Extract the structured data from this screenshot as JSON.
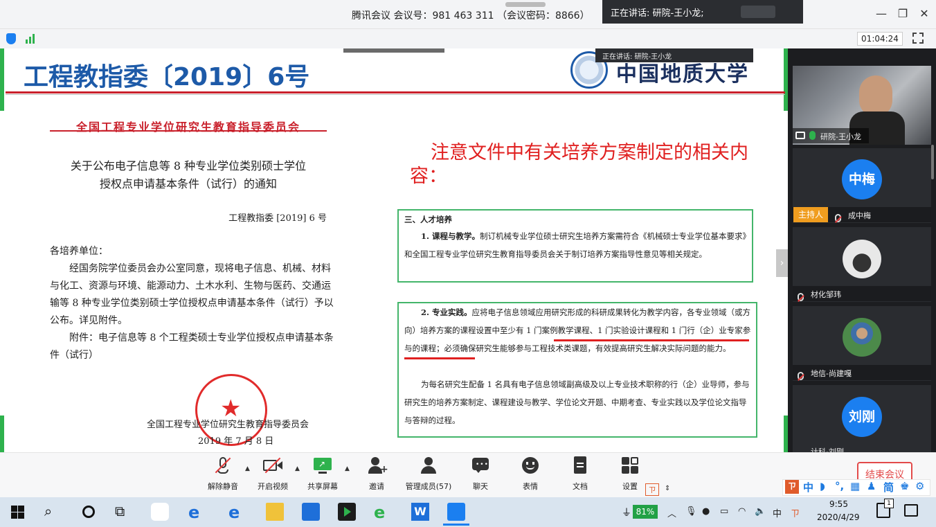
{
  "window": {
    "meeting_title": "腾讯会议 会议号：981 463 311 （会议密码：8866）",
    "speaking_label": "正在讲话: 研院-王小龙;",
    "timer": "01:04:24",
    "minimize": "—",
    "restore": "❐",
    "close": "✕"
  },
  "overlay": {
    "speaking_small": "正在讲话: 研院-王小龙"
  },
  "slide": {
    "header_title": "工程教指委〔2019〕6号",
    "university_name": "中国地质大学",
    "committee_name": "全国工程专业学位研究生教育指导委员会",
    "notice_title_line1": "关于公布电子信息等 8 种专业学位类别硕士学位",
    "notice_title_line2": "授权点申请基本条件（试行）的通知",
    "doc_number": "工程教指委 [2019] 6 号",
    "salutation": "各培养单位：",
    "body_paragraph": "经国务院学位委员会办公室同意，现将电子信息、机械、材料与化工、资源与环境、能源动力、土木水利、生物与医药、交通运输等 8 种专业学位类别硕士学位授权点申请基本条件（试行）予以公布。详见附件。",
    "attachment": "附件：电子信息等 8 个工程类硕士专业学位授权点申请基本条件（试行）",
    "sign_org": "全国工程专业学位研究生教育指导委员会",
    "sign_date": "2019 年 7 月 8 日",
    "note_heading": "注意文件中有关培养方案制定的相关内容：",
    "box1": {
      "section": "三、人才培养",
      "para_bold": "1. 课程与教学。",
      "para": "制订机械专业学位硕士研究生培养方案需符合《机械硕士专业学位基本要求》和全国工程专业学位研究生教育指导委员会关于制订培养方案指导性意见等相关规定。"
    },
    "box2": {
      "para1_bold": "2. 专业实践。",
      "para1": "应将电子信息领域应用研究形成的科研成果转化为教学内容，各专业领域（或方向）培养方案的课程设置中至少有 1 门案例教学课程、1 门实验设计课程和 1 门行（企）业专家参与的课程；必须确保研究生能够参与工程技术类课题，有效提高研究生解决实际问题的能力。",
      "para2": "为每名研究生配备 1 名具有电子信息领域副高级及以上专业技术职称的行（企）业导师，参与研究生的培养方案制定、课程建设与教学、学位论文开题、中期考查、专业实践以及学位论文指导与答辩的过程。"
    }
  },
  "participants": [
    {
      "name": "研院-王小龙",
      "type": "video"
    },
    {
      "name": "成中梅",
      "avatar_text": "中梅",
      "role": "主持人"
    },
    {
      "name": "材化邹玮",
      "type": "photo"
    },
    {
      "name": "地信-尚建嘎",
      "type": "photo"
    },
    {
      "name": "计科-刘刚",
      "avatar_text": "刘刚"
    }
  ],
  "host_badge": "主持人",
  "toolbar": {
    "mute": "解除静音",
    "video": "开启视频",
    "share": "共享屏幕",
    "invite": "邀请",
    "members": "管理成员(57)",
    "chat": "聊天",
    "emoji": "表情",
    "docs": "文档",
    "settings": "设置",
    "end_meeting": "结束会议"
  },
  "ime": {
    "chinese": "中",
    "simplified": "简"
  },
  "taskbar": {
    "battery": "81%",
    "time": "9:55",
    "date": "2020/4/29",
    "ime_label": "中",
    "notification_count": "1"
  },
  "colors": {
    "accent_blue": "#1b7ff0",
    "slide_title_blue": "#1d5aa8",
    "alert_red": "#e02020",
    "box_green": "#43b56a",
    "host_orange": "#f09d1f"
  }
}
